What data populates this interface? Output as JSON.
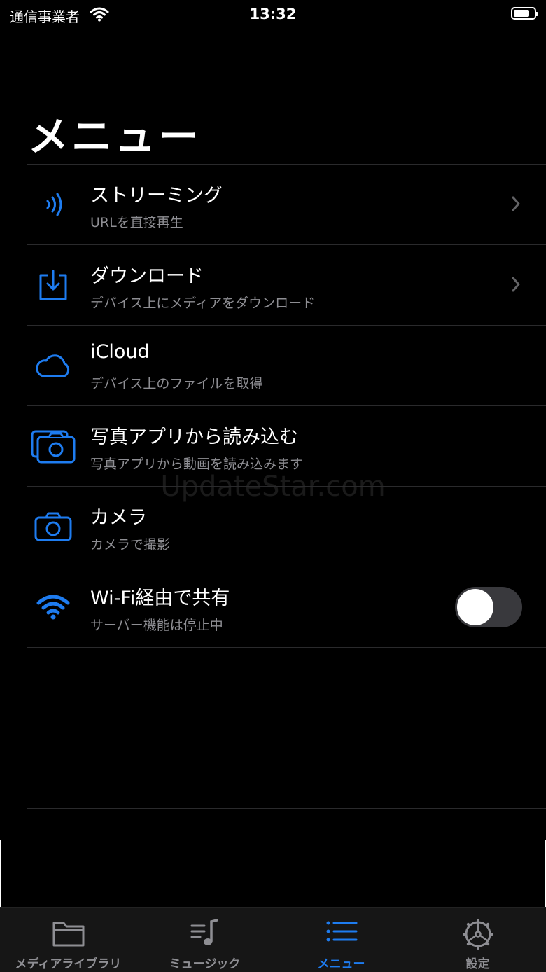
{
  "status": {
    "carrier": "通信事業者",
    "time": "13:32"
  },
  "page": {
    "title": "メニュー"
  },
  "menu": [
    {
      "title": "ストリーミング",
      "subtitle": "URLを直接再生",
      "icon": "streaming-icon"
    },
    {
      "title": "ダウンロード",
      "subtitle": "デバイス上にメディアをダウンロード",
      "icon": "download-icon"
    },
    {
      "title": "iCloud",
      "subtitle": "デバイス上のファイルを取得",
      "icon": "cloud-icon"
    },
    {
      "title": "写真アプリから読み込む",
      "subtitle": "写真アプリから動画を読み込みます",
      "icon": "photos-icon"
    },
    {
      "title": "カメラ",
      "subtitle": "カメラで撮影",
      "icon": "camera-icon"
    },
    {
      "title": "Wi-Fi経由で共有",
      "subtitle": "サーバー機能は停止中",
      "icon": "wifi-icon",
      "toggle_on": false
    }
  ],
  "watermark": "UpdateStar.com",
  "tabs": [
    {
      "label": "メディアライブラリ",
      "icon": "folder-icon"
    },
    {
      "label": "ミュージック",
      "icon": "music-icon"
    },
    {
      "label": "メニュー",
      "icon": "list-icon",
      "active": true
    },
    {
      "label": "設定",
      "icon": "gear-icon"
    }
  ],
  "colors": {
    "accent": "#1e7cf0",
    "background": "#000000",
    "secondary_text": "#8e8e93",
    "tab_bar": "#161616"
  }
}
